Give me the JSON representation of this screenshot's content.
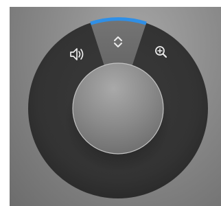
{
  "dial": {
    "segments": [
      {
        "name": "volume",
        "icon": "speaker-volume-icon",
        "selected": false
      },
      {
        "name": "scroll",
        "icon": "up-down-chevron-icon",
        "selected": true
      },
      {
        "name": "zoom",
        "icon": "zoom-in-icon",
        "selected": false
      }
    ],
    "colors": {
      "ring": "#333333",
      "selected_segment": "#6a6a6a",
      "accent": "#2f8fe6",
      "knob": "#8a8a8a",
      "icon": "#ececec"
    }
  }
}
